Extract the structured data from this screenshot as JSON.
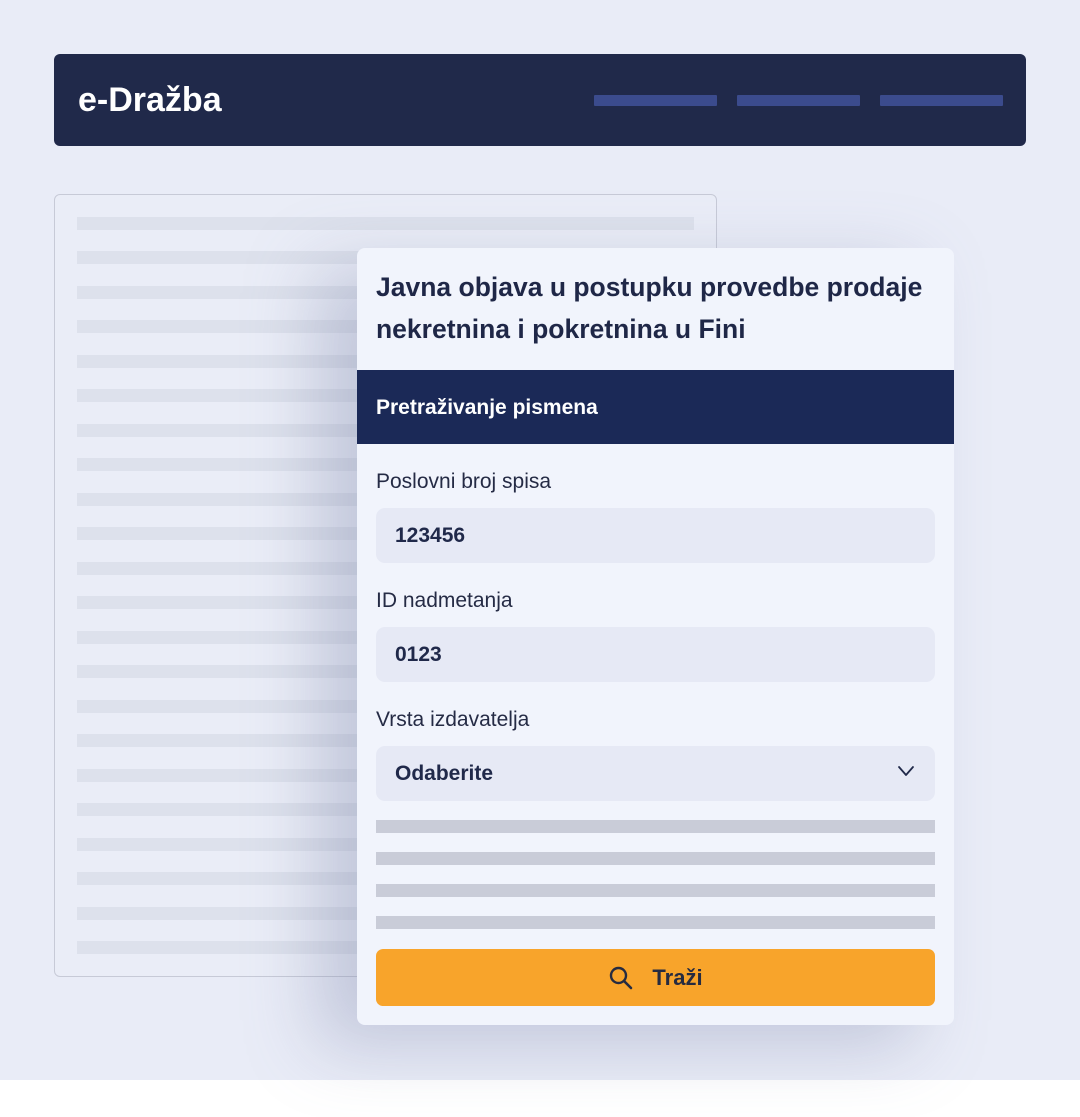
{
  "header": {
    "logo": "e-Dražba",
    "nav_placeholders": 3
  },
  "card": {
    "title": "Javna objava u postupku provedbe prodaje nekretnina i pokretnina u Fini",
    "section_title": "Pretraživanje pismena",
    "fields": [
      {
        "label": "Poslovni broj spisa",
        "value": "123456"
      },
      {
        "label": "ID nadmetanja",
        "value": "0123"
      },
      {
        "label": "Vrsta izdavatelja",
        "value": "Odaberite"
      }
    ],
    "search_button": {
      "label": "Traži",
      "icon": "search-icon"
    }
  },
  "colors": {
    "header_bg": "#20294a",
    "section_bg": "#1b2957",
    "accent": "#f8a42b",
    "page_bg": "#e9ecf7",
    "card_bg": "#f1f4fc"
  }
}
